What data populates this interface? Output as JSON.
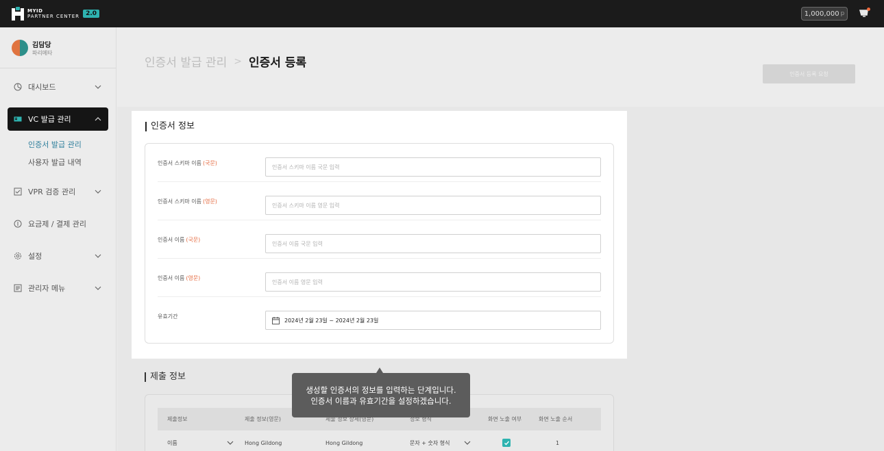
{
  "topbar": {
    "logo_line1": "MYID",
    "logo_line2": "PARTNER CENTER",
    "version": "2.0",
    "points": "1,000,000",
    "points_unit": "p",
    "bell_icon": "notification-bell-icon"
  },
  "profile": {
    "name": "김담당",
    "role": "파리메타"
  },
  "sidebar": {
    "items": [
      {
        "label": "대시보드",
        "icon": "dashboard-icon",
        "chevron": "down"
      },
      {
        "label": "VC 발급 관리",
        "icon": "id-card-icon",
        "chevron": "up",
        "active": true
      },
      {
        "label": "VPR 검증 관리",
        "icon": "checkbox-icon",
        "chevron": "down"
      },
      {
        "label": "요금제 / 결제 관리",
        "icon": "coin-icon"
      },
      {
        "label": "설정",
        "icon": "gear-icon",
        "chevron": "down"
      },
      {
        "label": "관리자 메뉴",
        "icon": "list-icon",
        "chevron": "down"
      }
    ],
    "subitems": [
      {
        "label": "인증서 발급 관리",
        "selected": true
      },
      {
        "label": "사용자 발급 내역"
      }
    ]
  },
  "header": {
    "breadcrumb_parent": "인증서 발급 관리",
    "breadcrumb_current": "인증서 등록",
    "submit_button": "인증서 등록 요청"
  },
  "certificate_info": {
    "title": "인증서 정보",
    "fields": [
      {
        "label": "인증서 스키마 이름",
        "tag": "(국문)",
        "placeholder": "인증서 스키마 이름 국문 입력"
      },
      {
        "label": "인증서 스키마 이름",
        "tag": "(영문)",
        "placeholder": "인증서 스키마 이름 영문 입력"
      },
      {
        "label": "인증서 이름",
        "tag": "(국문)",
        "placeholder": "인증서 이름 국문 입력"
      },
      {
        "label": "인증서 이름",
        "tag": "(영문)",
        "placeholder": "인증서 이름 영문 입력"
      }
    ],
    "validity": {
      "label": "유효기간",
      "value": "2024년 2월 23일 ~ 2024년 2월 23일"
    }
  },
  "submission_info": {
    "title": "제출 정보",
    "columns": [
      "제출정보",
      "제출 정보(영문)",
      "제출 정보 상세(영문)",
      "정보 형식",
      "화면 노출 여부",
      "화면 노출 순서"
    ],
    "rows": [
      {
        "field": "이름",
        "english": "Hong Gildong",
        "detail_english": "Hong Gildong",
        "format": "문자 + 숫자 형식",
        "visible": true,
        "order": "1"
      }
    ]
  },
  "tooltip": {
    "line1": "생성할 인증서의 정보를 입력하는 단계입니다.",
    "line2": "인증서 이름과 유효기간을 설정하겠습니다."
  },
  "colors": {
    "accent": "#2eb3b0",
    "required": "#e56a3f",
    "link": "#2f7f9c"
  }
}
